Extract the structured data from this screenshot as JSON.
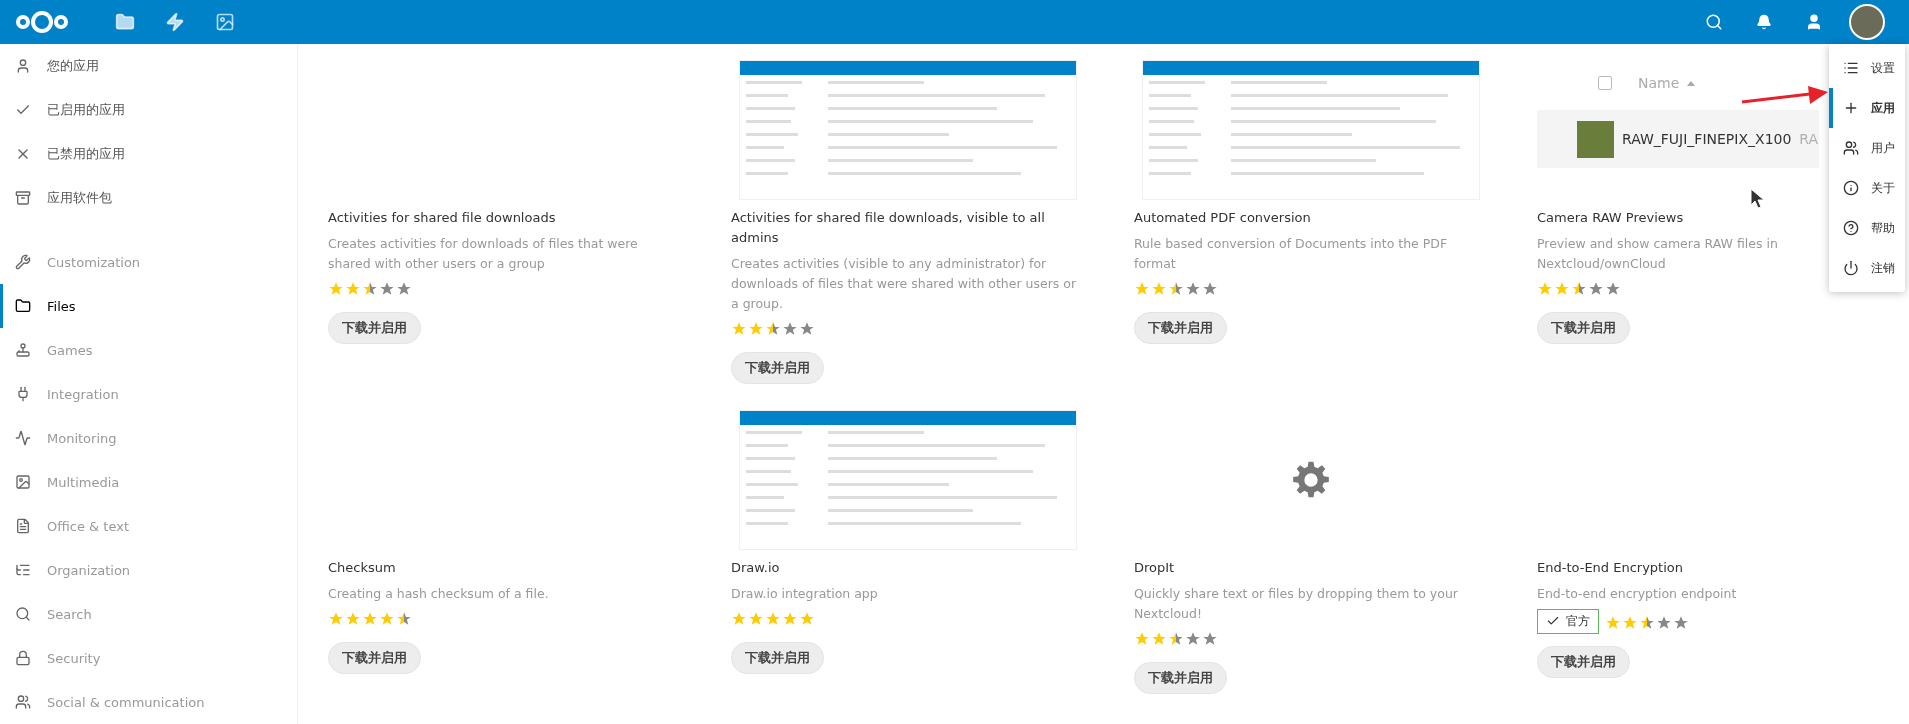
{
  "sidebar": {
    "app_sections": [
      {
        "label": "您的应用",
        "selected": false
      },
      {
        "label": "已启用的应用",
        "selected": false
      },
      {
        "label": "已禁用的应用",
        "selected": false
      },
      {
        "label": "应用软件包",
        "selected": false
      }
    ],
    "categories": [
      {
        "label": "Customization",
        "selected": false
      },
      {
        "label": "Files",
        "selected": true
      },
      {
        "label": "Games",
        "selected": false
      },
      {
        "label": "Integration",
        "selected": false
      },
      {
        "label": "Monitoring",
        "selected": false
      },
      {
        "label": "Multimedia",
        "selected": false
      },
      {
        "label": "Office & text",
        "selected": false
      },
      {
        "label": "Organization",
        "selected": false
      },
      {
        "label": "Search",
        "selected": false
      },
      {
        "label": "Security",
        "selected": false
      },
      {
        "label": "Social & communication",
        "selected": false
      }
    ]
  },
  "cards": [
    {
      "preview": {
        "kind": "none"
      },
      "title": "Activities for shared file downloads",
      "description": "Creates activities for downloads of files that were shared with other users or a group",
      "stars": 2.5,
      "button": "下载并启用"
    },
    {
      "preview": {
        "kind": "screenshot"
      },
      "title": "Activities for shared file downloads, visible to all admins",
      "description": "Creates activities (visible to any administrator) for downloads of files that were shared with other users or a group.",
      "stars": 2.5,
      "button": "下载并启用"
    },
    {
      "preview": {
        "kind": "screenshot"
      },
      "title": "Automated PDF conversion",
      "description": "Rule based conversion of Documents into the PDF format",
      "stars": 2.5,
      "button": "下载并启用"
    },
    {
      "preview": {
        "kind": "file_list",
        "checked": false,
        "column": "Name",
        "file": "RAW_FUJI_FINEPIX_X100",
        "extension": "RA"
      },
      "title": "Camera RAW Previews",
      "description": "Preview and show camera RAW files in Nextcloud/ownCloud",
      "stars": 2.5,
      "button": "下载并启用"
    },
    {
      "preview": {
        "kind": "none"
      },
      "title": "Checksum",
      "description": "Creating a hash checksum of a file.",
      "stars": 4.5,
      "button": "下载并启用"
    },
    {
      "preview": {
        "kind": "screenshot"
      },
      "title": "Draw.io",
      "description": "Draw.io integration app",
      "stars": 5,
      "button": "下载并启用"
    },
    {
      "preview": {
        "kind": "gear"
      },
      "title": "DropIt",
      "description": "Quickly share text or files by dropping them to your Nextcloud!",
      "stars": 2.5,
      "button": "下载并启用"
    },
    {
      "preview": {
        "kind": "none"
      },
      "title": "End-to-End Encryption",
      "description": "End-to-end encryption endpoint",
      "official_badge": "官方",
      "stars": 2.5,
      "button": "下载并启用"
    }
  ],
  "user_menu": [
    {
      "label": "设置",
      "selected": false
    },
    {
      "label": "应用",
      "selected": true
    },
    {
      "label": "用户",
      "selected": false
    },
    {
      "label": "关于",
      "selected": false
    },
    {
      "label": "帮助",
      "selected": false
    },
    {
      "label": "注销",
      "selected": false
    }
  ]
}
